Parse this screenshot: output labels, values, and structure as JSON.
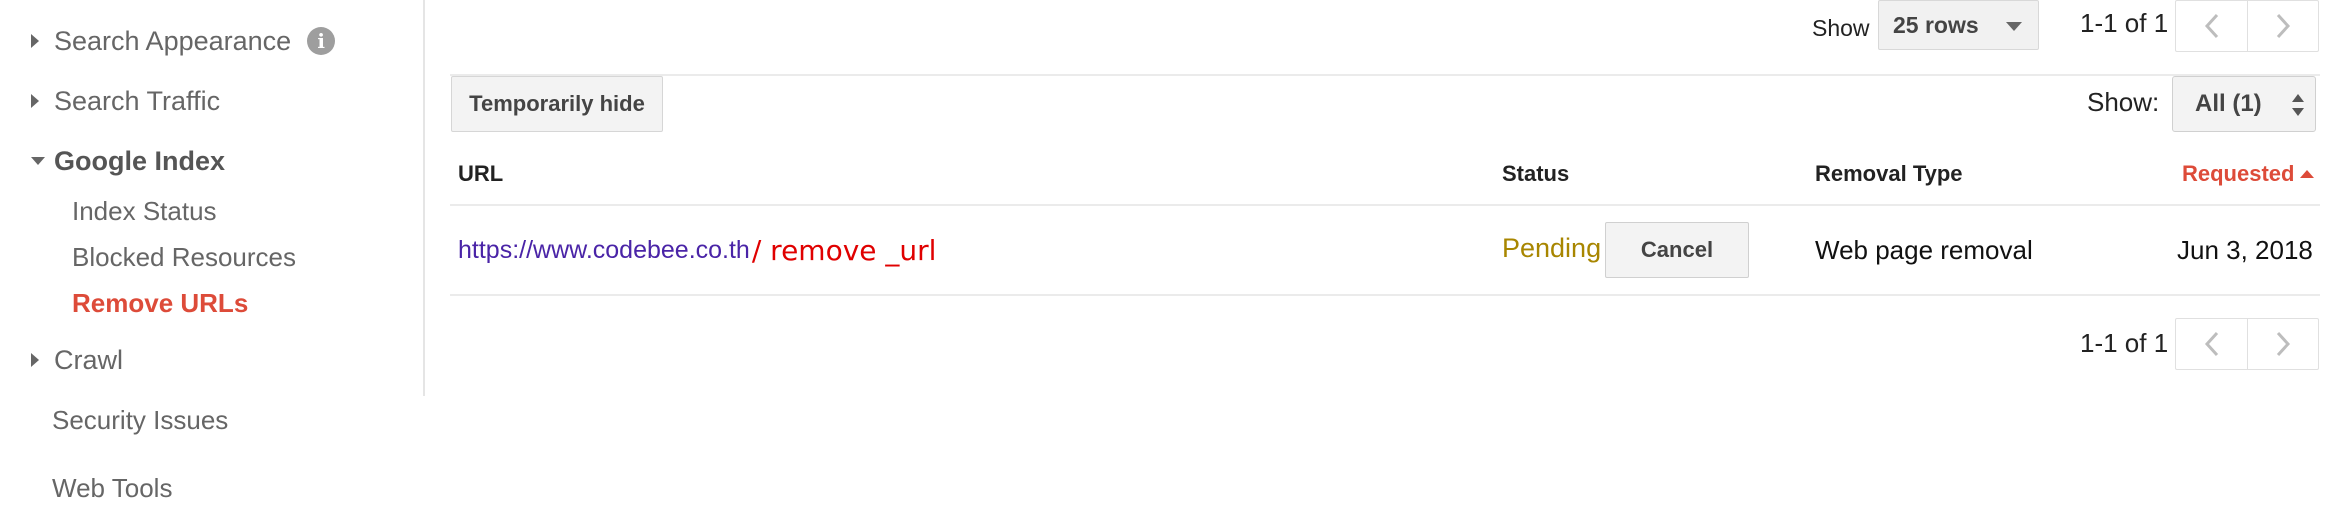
{
  "sidebar": {
    "items": [
      {
        "label": "Search Appearance",
        "expanded": false,
        "has_info": true
      },
      {
        "label": "Search Traffic",
        "expanded": false
      },
      {
        "label": "Google Index",
        "expanded": true,
        "children": [
          {
            "label": "Index Status"
          },
          {
            "label": "Blocked Resources"
          },
          {
            "label": "Remove URLs",
            "current": true
          }
        ]
      },
      {
        "label": "Crawl",
        "expanded": false
      },
      {
        "label": "Security Issues"
      },
      {
        "label": "Web Tools"
      }
    ],
    "info_glyph": "i"
  },
  "pager_top": {
    "show_label": "Show",
    "rows_value": "25 rows",
    "range_text": "1-1 of 1"
  },
  "toolbar": {
    "hide_button": "Temporarily hide",
    "filter_label": "Show:",
    "filter_value": "All (1)"
  },
  "table": {
    "columns": {
      "url": "URL",
      "status": "Status",
      "removal_type": "Removal Type",
      "requested": "Requested"
    },
    "sorted_column": "requested",
    "rows": [
      {
        "url_visible": "https://www.codebee.co.th",
        "url_overlay": "/ remove _url",
        "status": "Pending",
        "cancel_label": "Cancel",
        "removal_type": "Web page removal",
        "requested": "Jun 3, 2018"
      }
    ]
  },
  "pager_bottom": {
    "range_text": "1-1 of 1"
  },
  "colors": {
    "accent_red": "#dd4b39",
    "link_purple": "#4a24a7",
    "pending_gold": "#a88600",
    "overlay_red": "#e00000"
  },
  "icons": {
    "collapsed": "caret-right-icon",
    "expanded": "caret-down-icon",
    "prev": "chevron-left-icon",
    "next": "chevron-right-icon",
    "info": "info-icon",
    "dropdown": "dropdown-arrow-icon",
    "updown": "sort-updown-icon"
  }
}
